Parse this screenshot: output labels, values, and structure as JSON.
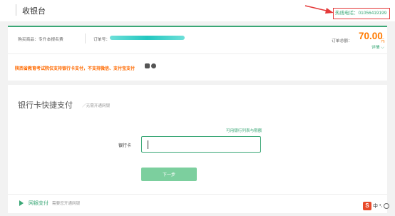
{
  "header": {
    "title": "收银台",
    "hotline": "热线电话：01056419199"
  },
  "order": {
    "goods_label": "购买商品：专升本报名费",
    "order_no_label": "订单号：",
    "total_label": "订单总额：",
    "total_value": "70.00",
    "currency": "元",
    "detail_link": "详情 ⌵",
    "notice": "陕西省教育考试院仅支持银行卡支付，不支持微信、支付宝支付"
  },
  "payment": {
    "title": "银行卡快捷支付",
    "subtitle": "／无需开通网银",
    "supported_banks_link": "可用银行列表与限额",
    "card_label": "银行卡",
    "card_value": "",
    "next_button": "下一步",
    "netbank_label": "网银支付",
    "netbank_sub": "需要您开通网银"
  },
  "ime": {
    "logo": "S",
    "text": "中",
    "dot": "•,",
    "icon": "smile-icon"
  },
  "colors": {
    "accent": "#3aa776",
    "price": "#ff7a00",
    "notice": "#ff6a00",
    "highlight": "#e43a3a"
  }
}
